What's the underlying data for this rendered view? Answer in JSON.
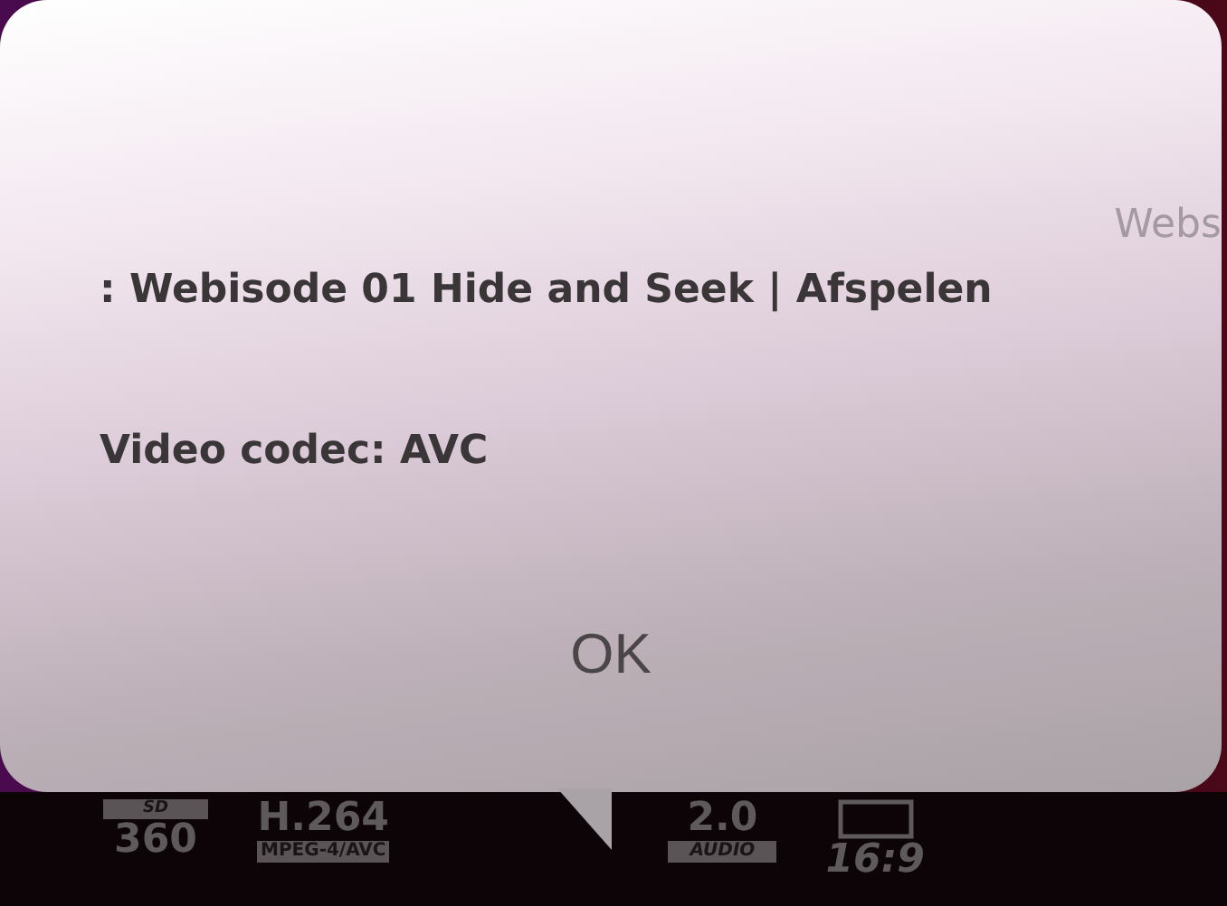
{
  "dialog": {
    "lines": [
      {
        "kind": "title",
        "text": ": Webisode 01 Hide and Seek | Afspelen"
      },
      {
        "kind": "detail",
        "text": "Video codec: AVC"
      }
    ],
    "ghost_text": "Webs",
    "button": "OK"
  },
  "info_bar": [
    {
      "kind": "badge-top",
      "label": "SD",
      "value": "360"
    },
    {
      "kind": "badge-bottom",
      "value": "H.264",
      "label": "MPEG-4/AVC"
    },
    {
      "kind": "badge-bottom",
      "value": "2.0",
      "label": "AUDIO"
    },
    {
      "kind": "screen-top",
      "value": "16:9"
    }
  ]
}
